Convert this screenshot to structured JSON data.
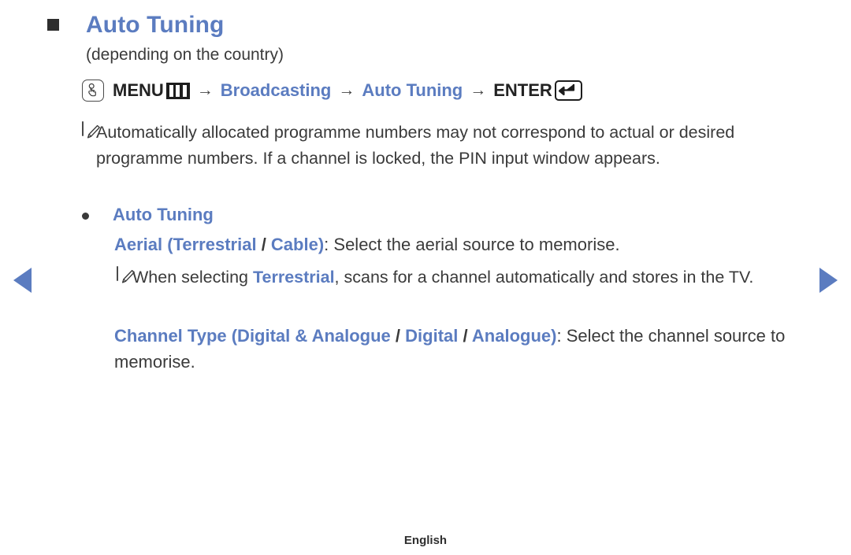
{
  "heading": {
    "bullet_icon": "filled-square-icon",
    "title": "Auto Tuning",
    "subtitle": "(depending on the country)"
  },
  "menu_path": {
    "press_icon": "remote-press-hand-icon",
    "menu_label": "MENU",
    "menu_glyph_icon": "menu-button-glyph-icon",
    "arrow_1": "→",
    "broadcasting_label": "Broadcasting",
    "arrow_2": "→",
    "auto_tuning_label": "Auto Tuning",
    "arrow_3": "→",
    "enter_label": "ENTER",
    "enter_glyph_icon": "enter-return-glyph-icon"
  },
  "note_1": {
    "icon": "note-pen-icon",
    "text": "Automatically allocated programme numbers may not correspond to actual or desired programme numbers. If a channel is locked, the PIN input window appears."
  },
  "bullet_item": {
    "dot_icon": "bullet-dot-icon",
    "label": "Auto Tuning"
  },
  "aerial_desc": {
    "part_label": "Aerial (Terrestrial",
    "separator": " / ",
    "part_label_2": "Cable)",
    "rest": ": Select the aerial source to memorise."
  },
  "note_2": {
    "icon": "note-pen-icon",
    "text_before": "When selecting ",
    "highlight": "Terrestrial",
    "text_after": ", scans for a channel automatically and stores in the TV."
  },
  "channel_type_desc": {
    "part_label": "Channel Type (Digital & Analogue",
    "separator_1": " / ",
    "part_label_2": "Digital",
    "separator_2": " / ",
    "part_label_3": "Analogue)",
    "rest": ": Select the channel source to memorise."
  },
  "navigation": {
    "prev_icon": "previous-page-arrow-icon",
    "next_icon": "next-page-arrow-icon"
  },
  "footer": {
    "language": "English"
  },
  "colors": {
    "accent_blue": "#5b7cc0",
    "body_text": "#3a3a3a",
    "heading_square": "#2e2e2e",
    "background": "#ffffff"
  }
}
